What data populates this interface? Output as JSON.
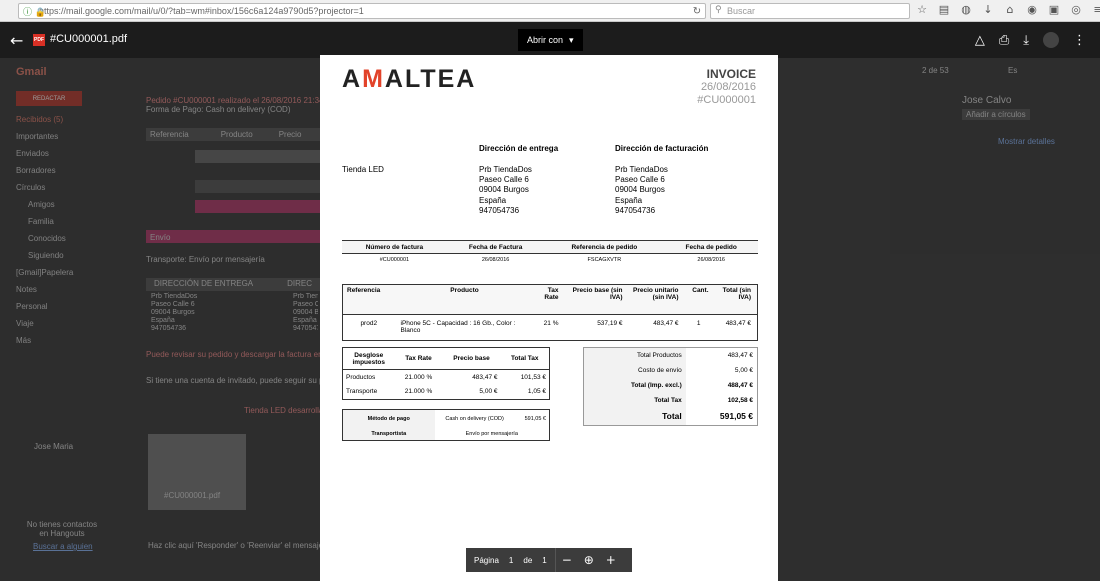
{
  "browser": {
    "url": "https://mail.google.com/mail/u/0/?tab=wm#inbox/156c6a124a9790d5?projector=1",
    "search_placeholder": "Buscar",
    "url_icons": [
      "info-icon",
      "lock-icon"
    ],
    "toolbar_icons": [
      "star-icon",
      "reader-icon",
      "pocket-icon",
      "download-icon",
      "home-icon",
      "chat-icon",
      "extension-icon",
      "addon-icon",
      "menu-icon"
    ]
  },
  "viewer": {
    "file_name": "#CU000001.pdf",
    "open_with": "Abrir con",
    "actions": [
      "drive-icon",
      "print-icon",
      "download-icon",
      "more-icon"
    ]
  },
  "gmail_bg": {
    "logo": "Gmail",
    "compose": "REDACTAR",
    "sidebar": [
      "Recibidos (5)",
      "Importantes",
      "Enviados",
      "Borradores",
      "Círculos",
      "Amigos",
      "Familia",
      "Conocidos",
      "Siguiendo",
      "[Gmail]Papelera",
      "Notes",
      "Personal",
      "Viaje",
      "Más"
    ],
    "user": "Jose Maria",
    "contact_name": "Jose Calvo",
    "page_count": "2 de 53",
    "lang": "Es",
    "attachment_name": "#CU000001.pdf",
    "reply_hint": "Haz clic aquí 'Responder' o 'Reenviar' el mensaje",
    "no_contacts": "No tienes contactos en Hangouts",
    "find_someone": "Buscar a alguien",
    "add_to_circles": "Añadir a círculos",
    "show_details": "Mostrar detalles",
    "order_line": "Pedido #CU000001 realizado el 26/08/2016 21:34:21",
    "payment_line": "Forma de Pago: Cash on delivery (COD)",
    "table_headers": [
      "Referencia",
      "Producto",
      "Precio"
    ],
    "shipping_label": "Envío",
    "shipping_line": "Transporte: Envío por mensajería",
    "delivery_address_header": "DIRECCIÓN DE ENTREGA",
    "billing_header_fragment": "DIREC",
    "address_lines": [
      "Prb TiendaDos",
      "Paseo Calle 6",
      "09004 Burgos",
      "España",
      "947054736"
    ],
    "footer_lines": [
      "Puede revisar su pedido y descargar la factura en \"Historial de pedidos\" de la sección \"Mi cuenta\".",
      "Si tiene una cuenta de invitado, puede seguir su pedido desde nuestra tienda."
    ],
    "powered_by": "Tienda LED desarrollado por PrestaShop"
  },
  "invoice": {
    "logo_prefix": "A",
    "logo_accent": "M",
    "logo_suffix": "ALTEA",
    "title": "INVOICE",
    "date": "26/08/2016",
    "number": "#CU000001",
    "shop_name": "Tienda LED",
    "delivery_header": "Dirección de entrega",
    "billing_header": "Dirección de facturación",
    "delivery_lines": [
      "Prb TiendaDos",
      "Paseo Calle 6",
      "09004 Burgos",
      "España",
      "947054736"
    ],
    "billing_lines": [
      "Prb TiendaDos",
      "Paseo Calle 6",
      "09004 Burgos",
      "España",
      "947054736"
    ],
    "ref_headers": [
      "Número de factura",
      "Fecha de Factura",
      "Referencia de pedido",
      "Fecha de pedido"
    ],
    "ref_values": [
      "#CU000001",
      "26/08/2016",
      "FSCAGXVTR",
      "26/08/2016"
    ],
    "prod_headers": [
      "Referencia",
      "Producto",
      "Tax Rate",
      "Precio base (sin IVA)",
      "Precio unitario (sin IVA)",
      "Cant.",
      "Total (sin IVA)"
    ],
    "prod_row": [
      "prod2",
      "iPhone 5C - Capacidad : 16 Gb., Color : Blanco",
      "21 %",
      "537,19 €",
      "483,47 €",
      "1",
      "483,47 €"
    ],
    "tax_headers": [
      "Desglose impuestos",
      "Tax Rate",
      "Precio base",
      "Total Tax"
    ],
    "tax_rows": [
      [
        "Productos",
        "21.000 %",
        "483,47 €",
        "101,53 €"
      ],
      [
        "Transporte",
        "21.000 %",
        "5,00 €",
        "1,05 €"
      ]
    ],
    "totals": [
      [
        "Total Productos",
        "483,47 €"
      ],
      [
        "Costo de envío",
        "5,00 €"
      ],
      [
        "Total (Imp. excl.)",
        "488,47 €"
      ],
      [
        "Total Tax",
        "102,58 €"
      ],
      [
        "Total",
        "591,05 €"
      ]
    ],
    "payment": {
      "method_label": "Método de pago",
      "method_value": "Cash on delivery (COD)",
      "method_amount": "591,05 €",
      "carrier_label": "Transportista",
      "carrier_value": "Envío por mensajería"
    }
  },
  "pager": {
    "label": "Página",
    "current": "1",
    "of": "de",
    "total": "1"
  }
}
